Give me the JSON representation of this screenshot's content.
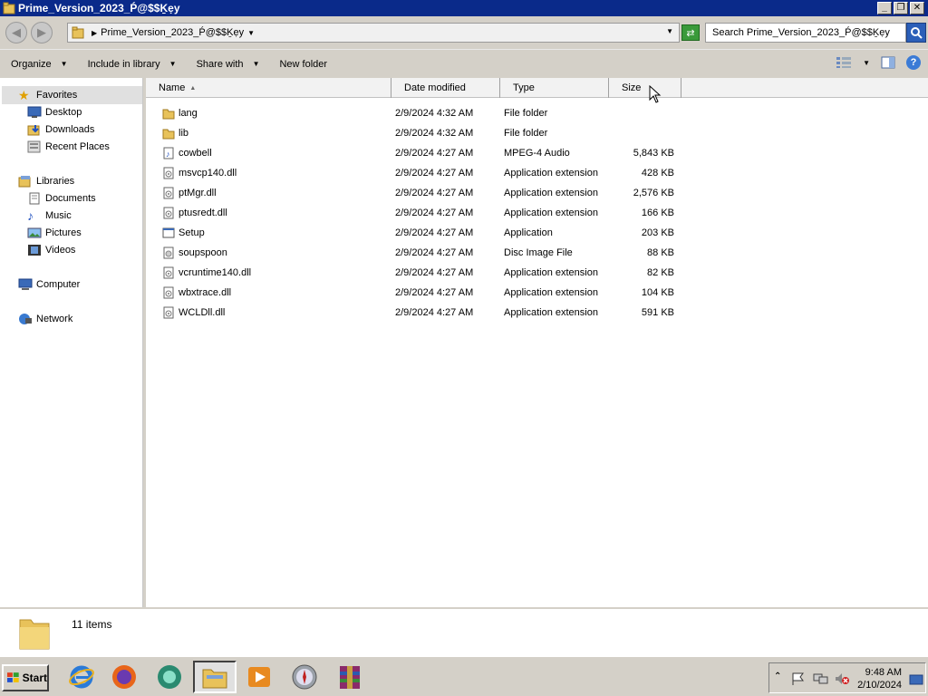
{
  "window": {
    "title": "Prime_Version_2023_Ṕ@$$Ḵẹy"
  },
  "address": {
    "crumb": "Prime_Version_2023_Ṕ@$$Ḵẹy",
    "search_placeholder": "Search Prime_Version_2023_Ṕ@$$Ḵẹy"
  },
  "toolbar": {
    "organize": "Organize",
    "include_in_library": "Include in library",
    "share_with": "Share with",
    "new_folder": "New folder"
  },
  "nav": {
    "favorites": "Favorites",
    "desktop": "Desktop",
    "downloads": "Downloads",
    "recent_places": "Recent Places",
    "libraries": "Libraries",
    "documents": "Documents",
    "music": "Music",
    "pictures": "Pictures",
    "videos": "Videos",
    "computer": "Computer",
    "network": "Network"
  },
  "columns": {
    "name": "Name",
    "date_modified": "Date modified",
    "type": "Type",
    "size": "Size"
  },
  "files": [
    {
      "name": "lang",
      "date": "2/9/2024 4:32 AM",
      "type": "File folder",
      "size": "",
      "icon": "folder-icon"
    },
    {
      "name": "lib",
      "date": "2/9/2024 4:32 AM",
      "type": "File folder",
      "size": "",
      "icon": "folder-icon"
    },
    {
      "name": "cowbell",
      "date": "2/9/2024 4:27 AM",
      "type": "MPEG-4 Audio",
      "size": "5,843 KB",
      "icon": "audio-file-icon"
    },
    {
      "name": "msvcp140.dll",
      "date": "2/9/2024 4:27 AM",
      "type": "Application extension",
      "size": "428 KB",
      "icon": "dll-file-icon"
    },
    {
      "name": "ptMgr.dll",
      "date": "2/9/2024 4:27 AM",
      "type": "Application extension",
      "size": "2,576 KB",
      "icon": "dll-file-icon"
    },
    {
      "name": "ptusredt.dll",
      "date": "2/9/2024 4:27 AM",
      "type": "Application extension",
      "size": "166 KB",
      "icon": "dll-file-icon"
    },
    {
      "name": "Setup",
      "date": "2/9/2024 4:27 AM",
      "type": "Application",
      "size": "203 KB",
      "icon": "application-icon"
    },
    {
      "name": "soupspoon",
      "date": "2/9/2024 4:27 AM",
      "type": "Disc Image File",
      "size": "88 KB",
      "icon": "disc-image-icon"
    },
    {
      "name": "vcruntime140.dll",
      "date": "2/9/2024 4:27 AM",
      "type": "Application extension",
      "size": "82 KB",
      "icon": "dll-file-icon"
    },
    {
      "name": "wbxtrace.dll",
      "date": "2/9/2024 4:27 AM",
      "type": "Application extension",
      "size": "104 KB",
      "icon": "dll-file-icon"
    },
    {
      "name": "WCLDll.dll",
      "date": "2/9/2024 4:27 AM",
      "type": "Application extension",
      "size": "591 KB",
      "icon": "dll-file-icon"
    }
  ],
  "status": {
    "item_count": "11 items"
  },
  "taskbar": {
    "start": "Start",
    "time": "9:48 AM",
    "date": "2/10/2024"
  },
  "colors": {
    "titlebar": "#0a2a8a",
    "chrome": "#d4d0c8",
    "folder": "#e8c25a"
  }
}
